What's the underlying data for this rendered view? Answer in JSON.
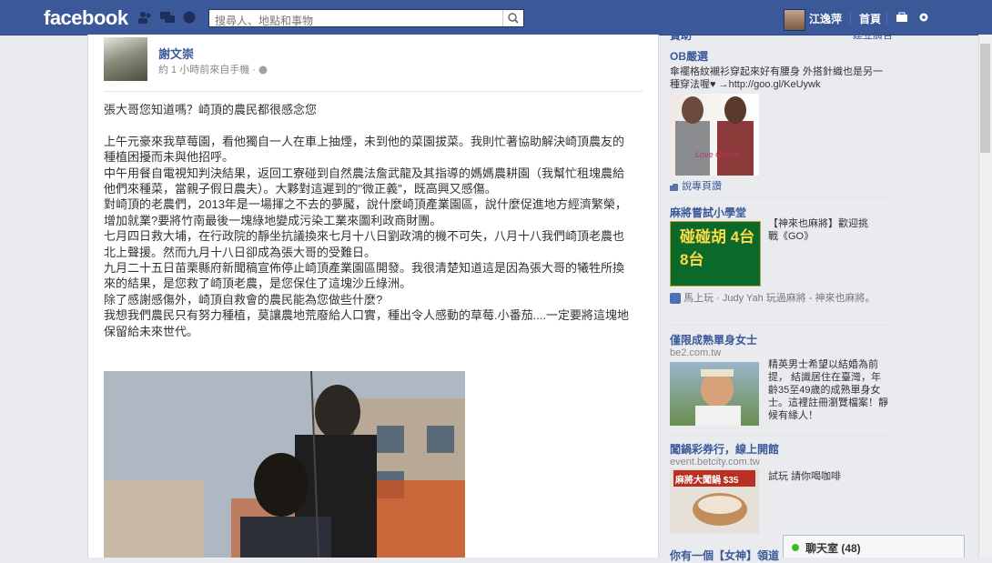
{
  "topbar": {
    "logo": "facebook",
    "search_placeholder": "搜尋人、地點和事物",
    "user_name": "江逸萍",
    "home_label": "首頁"
  },
  "post": {
    "author": "謝文崇",
    "meta": "約 1 小時前來自手機 ·",
    "paragraphs": [
      "張大哥您知道嗎？崎頂的農民都很感念您",
      "",
      "上午元豪來我草莓園，看他獨自一人在車上抽煙，未到他的菜園拔菜。我則忙著協助解決崎頂農友的種植困擾而未與他招呼。",
      "中午用餐自電視知判決結果，返回工寮碰到自然農法詹武龍及其指導的媽媽農耕園（我幫忙租塊農給他們來種菜，當親子假日農夫）。大夥對這遲到的\"微正義\"，既高興又感傷。",
      "對崎頂的老農們，2013年是一場揮之不去的夢魘，說什麼崎頂產業園區，說什麼促進地方經濟繁榮，增加就業?要將竹南最後一塊綠地變成污染工業來圖利政商財團。",
      "七月四日救大埔，在行政院的靜坐抗議換來七月十八日劉政鴻的機不可失，八月十八我們崎頂老農也北上聲援。然而九月十八日卻成為張大哥的受難日。",
      "九月二十五日苗栗縣府新聞稿宣佈停止崎頂產業園區開發。我很清楚知道這是因為張大哥的犧牲所換來的結果，是您救了崎頂老農，是您保住了這塊沙丘綠洲。",
      "除了感謝感傷外，崎頂自救會的農民能為您做些什麼?",
      "我想我們農民只有努力種植，莫讓農地荒廢給人口實，種出令人感動的草莓.小番茄....一定要將這塊地保留給未來世代。"
    ]
  },
  "sidebar": {
    "top_cut_left": "贊助",
    "top_cut_right": "建立廣告",
    "ads": [
      {
        "title": "OB嚴選",
        "url": "",
        "body": "傘襬格紋襯衫穿起來好有腰身 外搭針織也是另一種穿法喔♥ →http://goo.gl/KeUywk",
        "image_text": "Love Check"
      },
      {
        "title": "麻將嘗試小學堂",
        "url": "",
        "body": "【神來也麻將】歡迎挑戰《GO》",
        "image_text": "碰碰胡 4台 8台",
        "social": "馬上玩 · Judy Yah 玩過麻將 - 神來也麻將。"
      },
      {
        "title": "僅限成熟單身女士",
        "url": "be2.com.tw",
        "body": "精英男士希望以結婚為前提， 結識居住在臺灣，年齡35至49歲的成熟單身女士。這裡註冊瀏覽檔案！靜候有緣人！"
      },
      {
        "title": "闖鍋彩券行，線上開館",
        "url": "event.betcity.com.tw",
        "body": "試玩 請你喝咖啡",
        "image_text": "麻將大闖鍋 $35"
      }
    ],
    "like_page": "說專頁讚",
    "bottom_cut": "你有一個【女神】領道"
  },
  "chat": {
    "label": "聊天室 (48)"
  },
  "colors": {
    "fb_blue": "#3b5998",
    "link": "#3b5998"
  }
}
